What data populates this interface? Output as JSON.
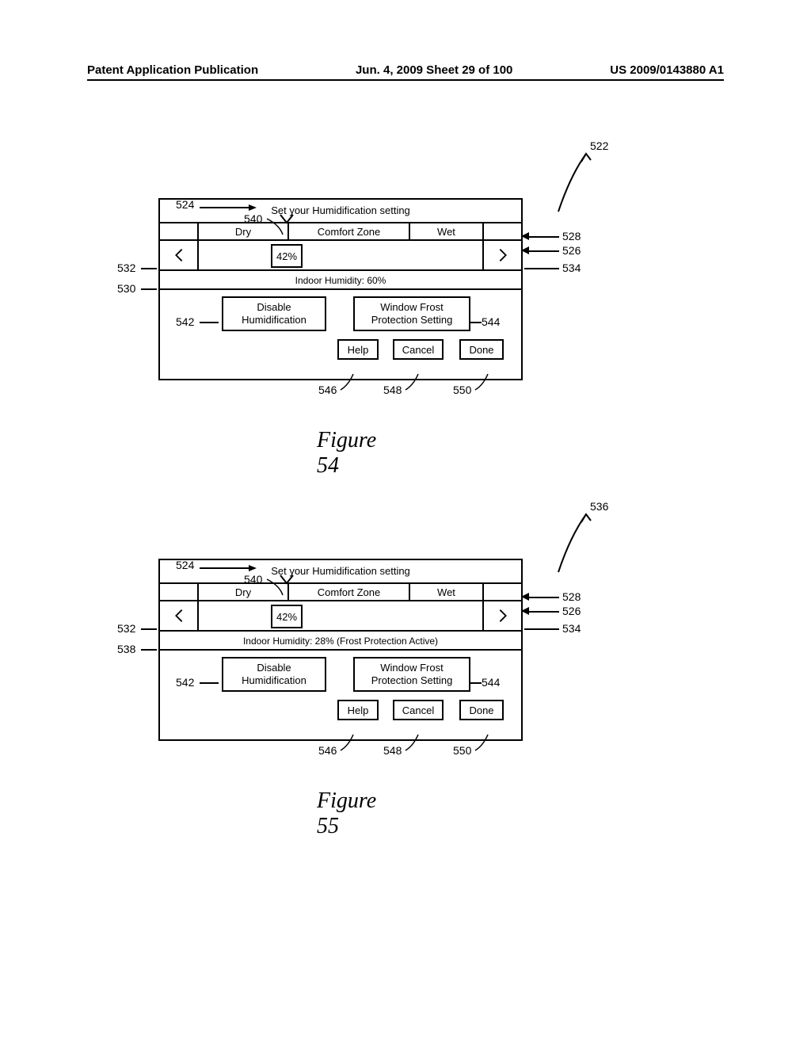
{
  "header": {
    "left": "Patent Application Publication",
    "center": "Jun. 4, 2009  Sheet 29 of 100",
    "right": "US 2009/0143880 A1"
  },
  "device": {
    "title": "Set your Humidification setting",
    "zones": {
      "dry": "Dry",
      "comfort": "Comfort Zone",
      "wet": "Wet"
    },
    "value": "42%",
    "status54": "Indoor Humidity: 60%",
    "status55": "Indoor Humidity: 28% (Frost Protection Active)",
    "disable_label": "Disable Humidification",
    "frost_label": "Window Frost Protection Setting",
    "help": "Help",
    "cancel": "Cancel",
    "done": "Done"
  },
  "refs": {
    "r522": "522",
    "r524": "524",
    "r526": "526",
    "r528": "528",
    "r530": "530",
    "r532": "532",
    "r534": "534",
    "r536": "536",
    "r538": "538",
    "r540": "540",
    "r542": "542",
    "r544": "544",
    "r546": "546",
    "r548": "548",
    "r550": "550"
  },
  "captions": {
    "f54": "Figure 54",
    "f55": "Figure 55"
  }
}
